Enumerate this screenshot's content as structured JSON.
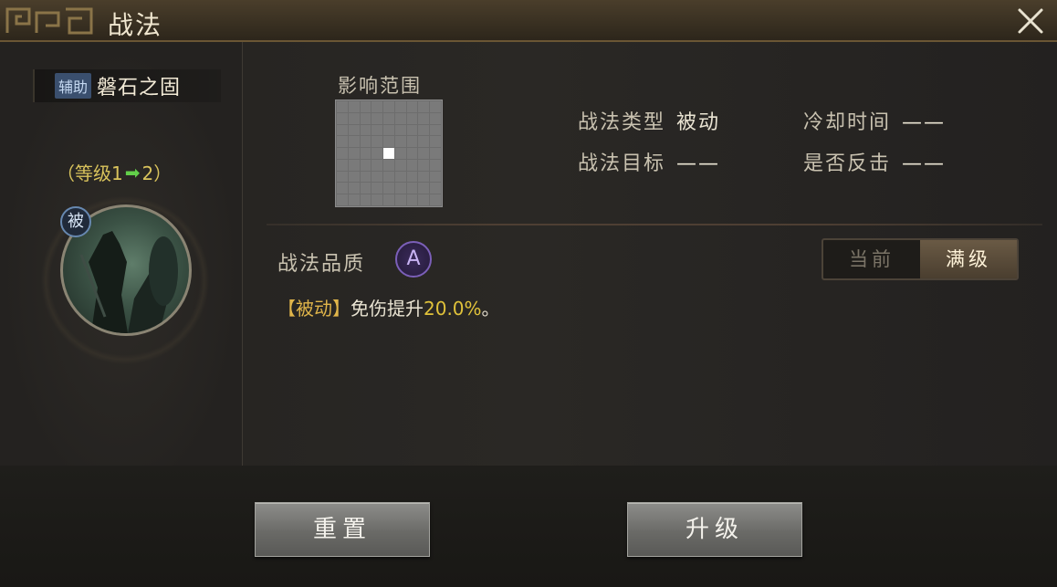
{
  "window": {
    "title": "战法"
  },
  "skill": {
    "role_tag": "辅助",
    "name": "磐石之固",
    "level_prefix": "（等级1",
    "level_arrow": "➡",
    "level_suffix": "2）",
    "passive_badge": "被"
  },
  "range": {
    "label": "影响范围",
    "grid_size": 9,
    "highlight_cell": [
      4,
      4
    ]
  },
  "info": {
    "type_label": "战法类型",
    "type_value": "被动",
    "target_label": "战法目标",
    "target_value": "——",
    "cooldown_label": "冷却时间",
    "cooldown_value": "——",
    "counter_label": "是否反击",
    "counter_value": "——"
  },
  "quality": {
    "label": "战法品质",
    "grade": "A"
  },
  "toggle": {
    "current": "当前",
    "max": "满级",
    "selected": "max"
  },
  "effect": {
    "tag": "【被动】",
    "text": "免伤提升",
    "value": "20.0%",
    "end": "。"
  },
  "buttons": {
    "reset": "重置",
    "upgrade": "升级"
  },
  "colors": {
    "accent_gold": "#e0c23a",
    "level_green": "#62d04a",
    "quality_purple": "#7b5fb8"
  }
}
